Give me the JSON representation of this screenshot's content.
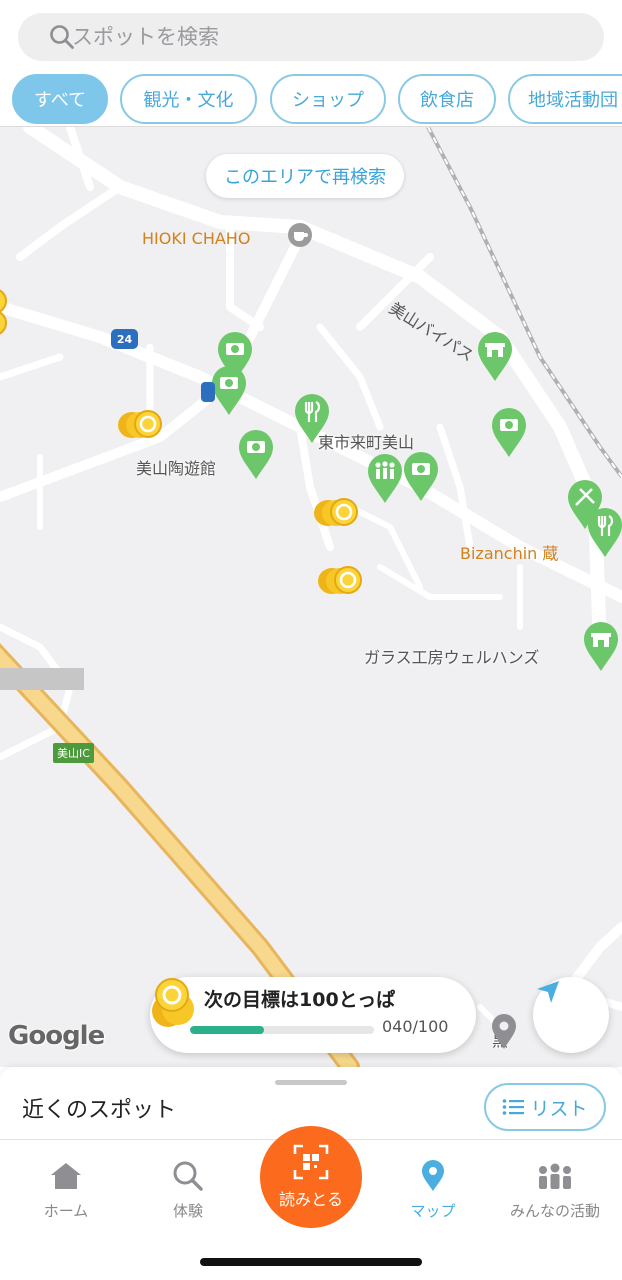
{
  "search": {
    "placeholder": "スポットを検索"
  },
  "categories": [
    {
      "label": "すべて",
      "active": true
    },
    {
      "label": "観光・文化",
      "active": false
    },
    {
      "label": "ショップ",
      "active": false
    },
    {
      "label": "飲食店",
      "active": false
    },
    {
      "label": "地域活動団",
      "active": false
    }
  ],
  "map": {
    "research_button": "このエリアで再検索",
    "labels": {
      "hioki": "HIOKI CHAHO",
      "bypass": "美山バイパス",
      "higashi": "東市来町美山",
      "toyuukan": "美山陶遊館",
      "bizanchin": "Bizanchin 蔵",
      "glass": "ガラス工房ウェルハンズ",
      "route": "24",
      "ic": "美山IC",
      "partial": "黒"
    },
    "attribution": "Google",
    "colors": {
      "pin_green": "#6cc76a",
      "poi_orange": "#d1811d",
      "road_yellow": "#f5d27a"
    }
  },
  "goal": {
    "title": "次の目標は100とっぱ",
    "count": "040/100",
    "progress": 0.4
  },
  "sheet": {
    "title": "近くのスポット",
    "list_button": "リスト"
  },
  "tabs": {
    "home": "ホーム",
    "experience": "体験",
    "scan": "読みとる",
    "map": "マップ",
    "activity": "みんなの活動"
  }
}
